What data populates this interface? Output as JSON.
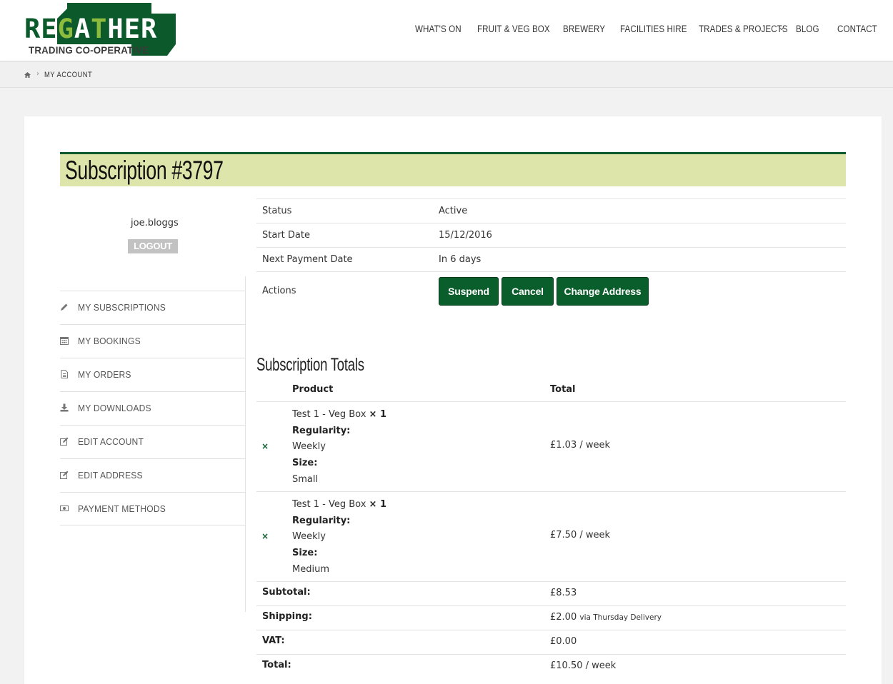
{
  "brand": {
    "name_letters": [
      "R",
      "E",
      "G",
      "A",
      "T",
      "H",
      "E",
      "R"
    ],
    "tagline": "TRADING CO-OPERATIVE",
    "green": "#0c5a2c",
    "lime": "#8dbb3c"
  },
  "nav": {
    "items": [
      "WHAT'S ON",
      "FRUIT & VEG BOX",
      "BREWERY",
      "FACILITIES HIRE",
      "TRADES & PROJECTS",
      "BLOG",
      "CONTACT"
    ]
  },
  "breadcrumb": {
    "home_icon": "home-icon",
    "separator": "›",
    "current": "MY ACCOUNT"
  },
  "page": {
    "title": "Subscription #3797",
    "title_bg": "#dde5ab"
  },
  "account": {
    "username": "joe.bloggs",
    "logout_label": "LOGOUT",
    "menu": [
      {
        "label": "MY SUBSCRIPTIONS",
        "icon": "pencil-icon"
      },
      {
        "label": "MY BOOKINGS",
        "icon": "calendar-icon"
      },
      {
        "label": "MY ORDERS",
        "icon": "document-icon"
      },
      {
        "label": "MY DOWNLOADS",
        "icon": "download-icon"
      },
      {
        "label": "EDIT ACCOUNT",
        "icon": "edit-icon"
      },
      {
        "label": "EDIT ADDRESS",
        "icon": "edit-icon"
      },
      {
        "label": "PAYMENT METHODS",
        "icon": "money-icon"
      }
    ]
  },
  "details": {
    "status_label": "Status",
    "status_value": "Active",
    "start_label": "Start Date",
    "start_value": "15/12/2016",
    "next_label": "Next Payment Date",
    "next_value": "In 6 days",
    "actions_label": "Actions",
    "buttons": {
      "suspend": "Suspend",
      "cancel": "Cancel",
      "change_address": "Change Address"
    }
  },
  "totals": {
    "heading": "Subscription Totals",
    "col_product": "Product",
    "col_total": "Total",
    "remove_symbol": "×",
    "items": [
      {
        "name": "Test 1 - Veg Box",
        "qty": "× 1",
        "reg_label": "Regularity:",
        "reg_value": "Weekly",
        "size_label": "Size:",
        "size_value": "Small",
        "total": "£1.03 / week"
      },
      {
        "name": "Test 1 - Veg Box",
        "qty": "× 1",
        "reg_label": "Regularity:",
        "reg_value": "Weekly",
        "size_label": "Size:",
        "size_value": "Medium",
        "total": "£7.50 / week"
      }
    ],
    "subtotal_label": "Subtotal:",
    "subtotal_value": "£8.53",
    "shipping_label": "Shipping:",
    "shipping_value": "£2.00",
    "shipping_note": "via Thursday Delivery",
    "vat_label": "VAT:",
    "vat_value": "£0.00",
    "total_label": "Total:",
    "total_value": "£10.50 / week"
  }
}
